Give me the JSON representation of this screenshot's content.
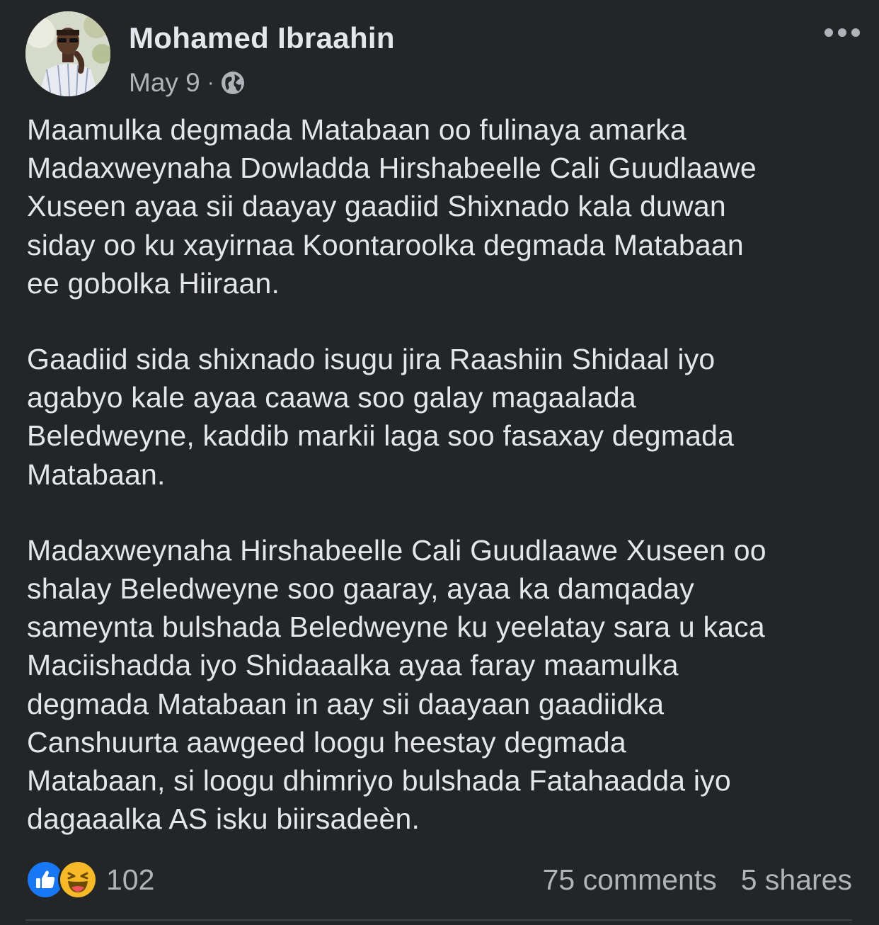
{
  "post": {
    "author": "Mohamed Ibraahin",
    "date": "May 9",
    "separator": "·",
    "privacy_icon": "globe-icon",
    "more_icon": "more-dots-icon",
    "paragraphs": [
      "Maamulka degmada Matabaan oo fulinaya amarka\nMadaxweynaha Dowladda Hirshabeelle Cali Guudlaawe\nXuseen ayaa sii daayay gaadiid  Shixnado kala duwan\nsiday oo ku xayirnaa Koontaroolka degmada Matabaan\nee gobolka Hiiraan.",
      "Gaadiid sida shixnado isugu jira Raashiin Shidaal iyo\nagabyo kale ayaa caawa soo galay magaalada\nBeledweyne, kaddib markii laga soo fasaxay degmada\nMatabaan.",
      "Madaxweynaha Hirshabeelle Cali Guudlaawe Xuseen oo\nshalay Beledweyne soo gaaray, ayaa ka damqaday\nsameynta bulshada Beledweyne ku yeelatay sara u kaca\nMaciishadda iyo Shidaaalka ayaa faray maamulka\ndegmada Matabaan in aay sii daayaan gaadiidka\nCanshuurta aawgeed loogu  heestay degmada\nMatabaan, si loogu dhimriyo bulshada Fatahaadda iyo\ndagaaalka AS isku biirsadeèn."
    ]
  },
  "engagement": {
    "reaction_icons": [
      "like-icon",
      "haha-icon"
    ],
    "reaction_count": "102",
    "comments": "75 comments",
    "shares": "5 shares"
  },
  "colors": {
    "background": "#242526",
    "primary_text": "#e4e6eb",
    "secondary_text": "#b0b3b8",
    "like_blue": "#1877f2",
    "haha_yellow": "#f7b928"
  }
}
